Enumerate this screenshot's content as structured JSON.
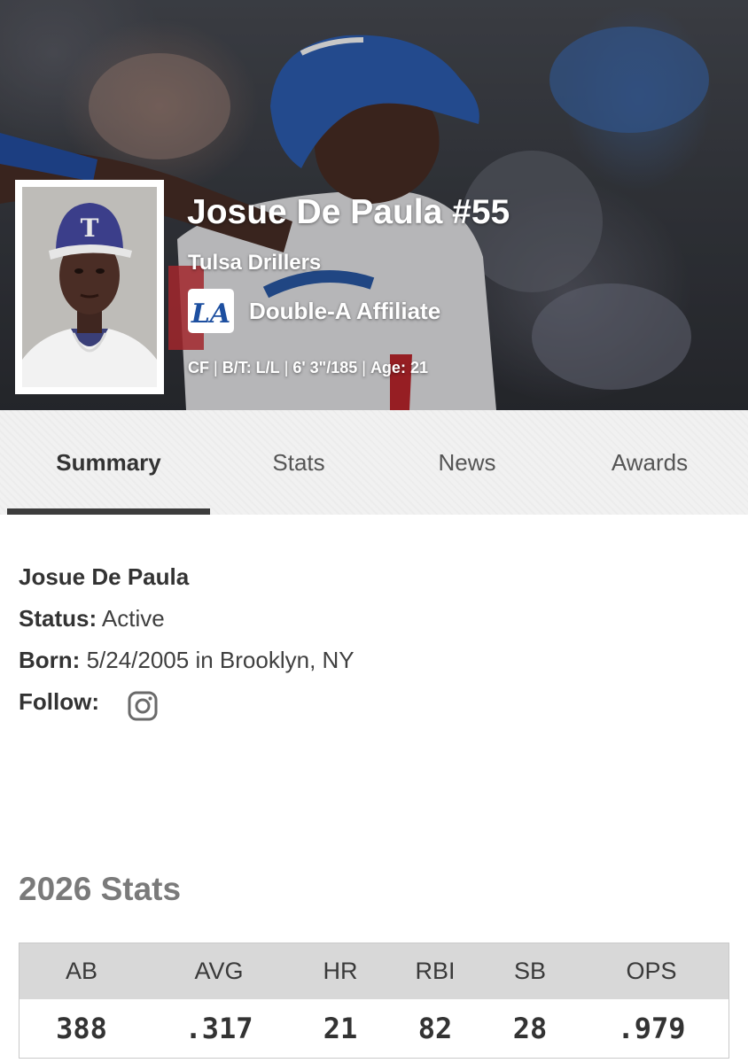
{
  "player": {
    "name_number": "Josue De Paula #55",
    "team": "Tulsa Drillers",
    "affiliate_logo": "LA",
    "affiliate": "Double-A Affiliate",
    "bio": {
      "position": "CF",
      "bats_throws": "B/T: L/L",
      "height_weight": "6' 3\"/185",
      "age": "Age: 21"
    }
  },
  "tabs": [
    {
      "label": "Summary",
      "active": true
    },
    {
      "label": "Stats",
      "active": false
    },
    {
      "label": "News",
      "active": false
    },
    {
      "label": "Awards",
      "active": false
    }
  ],
  "summary": {
    "full_name": "Josue De Paula",
    "status_label": "Status:",
    "status_value": "Active",
    "born_label": "Born:",
    "born_value": "5/24/2005 in Brooklyn, NY",
    "follow_label": "Follow:",
    "follow_icon": "instagram-icon"
  },
  "stats": {
    "title": "2026 Stats",
    "columns": [
      "AB",
      "AVG",
      "HR",
      "RBI",
      "SB",
      "OPS"
    ],
    "values": [
      "388",
      ".317",
      "21",
      "82",
      "28",
      ".979"
    ]
  },
  "colors": {
    "tab_underline": "#3c3c3c",
    "dodger_blue": "#1d4fa0",
    "stats_header_bg": "#d8d8d8"
  }
}
